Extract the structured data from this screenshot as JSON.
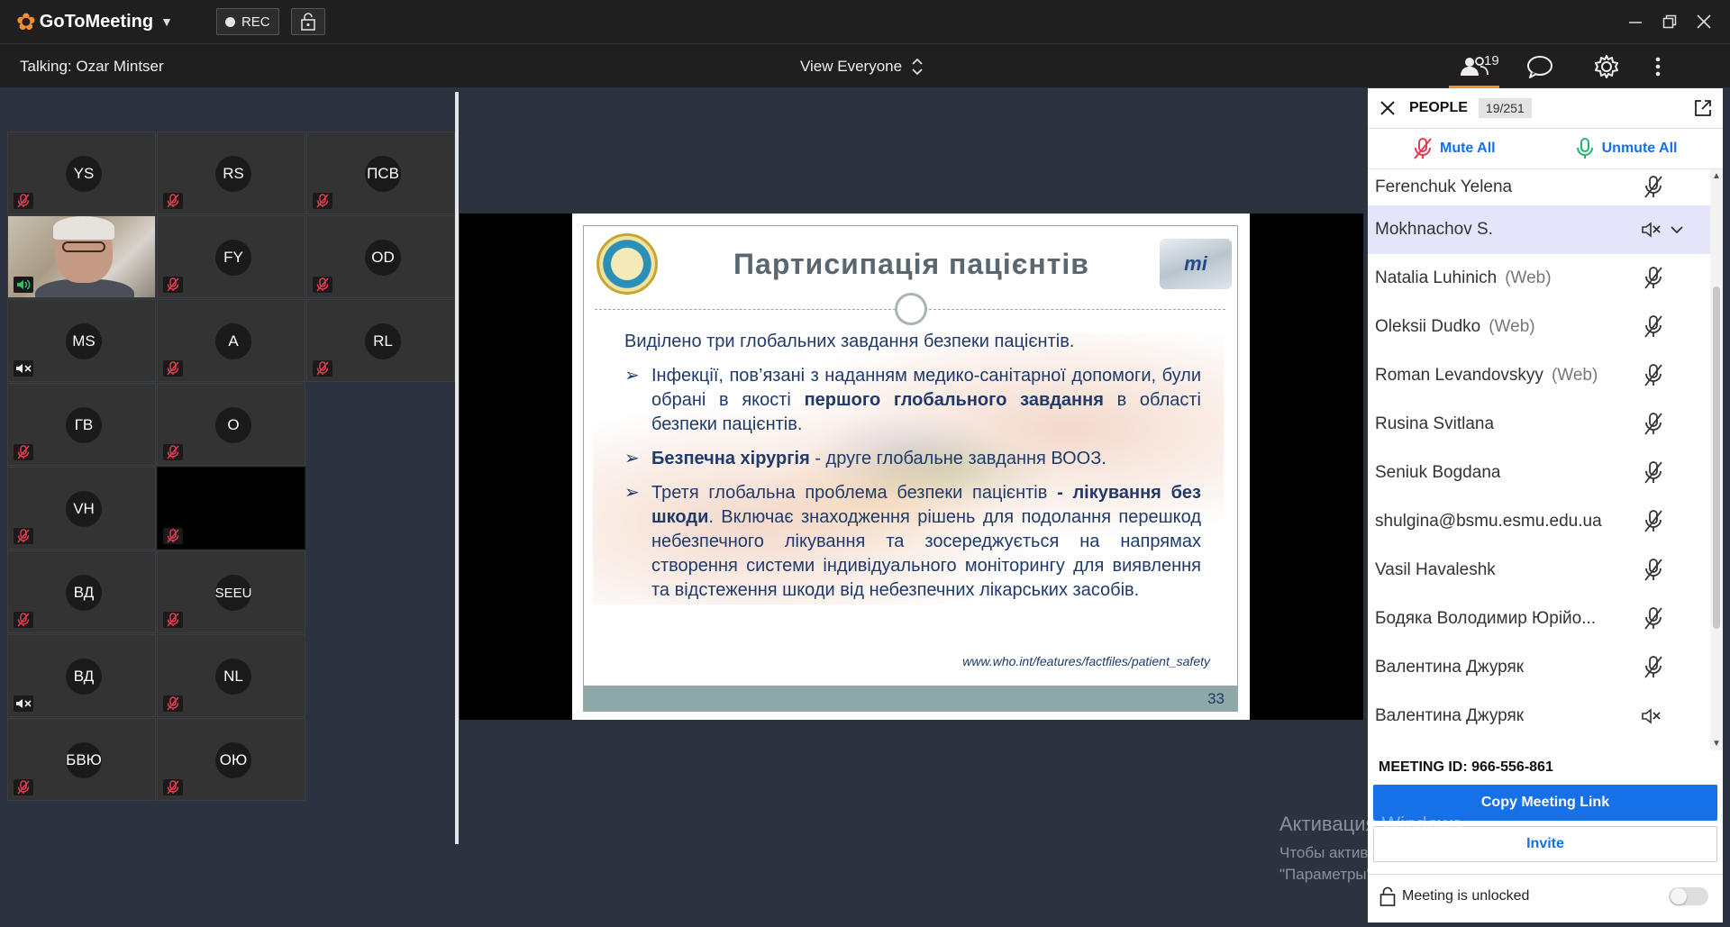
{
  "app": {
    "name": "GoToMeeting",
    "rec_label": "REC",
    "brand_orange": "#f68d2e",
    "accent_blue": "#1670e8"
  },
  "status": {
    "talking": "Talking: Ozar Mintser",
    "view_mode": "View Everyone",
    "attendee_count": "19"
  },
  "tiles": [
    {
      "initials": "YS",
      "mic": "muted"
    },
    {
      "initials": "RS",
      "mic": "muted"
    },
    {
      "initials": "ПСВ",
      "mic": "muted"
    },
    {
      "initials": "",
      "mic": "speaking",
      "video": true
    },
    {
      "initials": "FY",
      "mic": "muted"
    },
    {
      "initials": "OD",
      "mic": "muted"
    },
    {
      "initials": "MS",
      "mic": "speaker-off"
    },
    {
      "initials": "A",
      "mic": "muted"
    },
    {
      "initials": "RL",
      "mic": "muted"
    },
    {
      "initials": "ГВ",
      "mic": "muted"
    },
    {
      "initials": "О",
      "mic": "muted"
    },
    {
      "initials": "VH",
      "mic": "muted"
    },
    {
      "initials": "",
      "mic": "muted",
      "black": true
    },
    {
      "initials": "ВД",
      "mic": "muted"
    },
    {
      "initials": "SEEU",
      "mic": "muted"
    },
    {
      "initials": "ВД",
      "mic": "speaker-off"
    },
    {
      "initials": "NL",
      "mic": "muted"
    },
    {
      "initials": "БВЮ",
      "mic": "muted"
    },
    {
      "initials": "ОЮ",
      "mic": "muted"
    }
  ],
  "slide": {
    "title": "Партисипація пацієнтів",
    "logo_text": "mi",
    "intro": "Виділено три глобальних завдання безпеки пацієнтів.",
    "b1_pre": "Інфекції, пов’язані з наданням медико-санітарної допомоги, були обрані в якості ",
    "b1_bold": "першого глобального завдання",
    "b1_post": " в області безпеки пацієнтів.",
    "b2_bold": "Безпечна хірургія",
    "b2_post": "  -  друге глобальне завдання ВООЗ.",
    "b3_pre": "Третя глобальна проблема безпеки пацієнтів ",
    "b3_bold": "- лікування без шкоди",
    "b3_post": ". Включає знаходження рішень для подолання перешкод небезпечного лікування та зосереджується на напрямах створення системи індивідуального моніторингу для виявлення та відстеження шкоди від небезпечних лікарських засобів.",
    "source": "www.who.int/features/factfiles/patient_safety",
    "page_number": "33",
    "bullet_glyph": "➢"
  },
  "panel": {
    "title": "PEOPLE",
    "count_badge": "19/251",
    "mute_all": "Mute All",
    "unmute_all": "Unmute All",
    "people": [
      {
        "name": "Ferenchuk Yelena",
        "web": "",
        "status": "muted"
      },
      {
        "name": "Mokhnachov S.",
        "web": "",
        "status": "speaker-off",
        "selected": true
      },
      {
        "name": "Natalia Luhinich",
        "web": "(Web)",
        "status": "muted"
      },
      {
        "name": "Oleksii Dudko",
        "web": "(Web)",
        "status": "muted"
      },
      {
        "name": "Roman Levandovskyy",
        "web": "(Web)",
        "status": "muted"
      },
      {
        "name": "Rusina Svitlana",
        "web": "",
        "status": "muted"
      },
      {
        "name": "Seniuk Bogdana",
        "web": "",
        "status": "muted"
      },
      {
        "name": "shulgina@bsmu.esmu.edu.ua",
        "web": "",
        "status": "muted"
      },
      {
        "name": "Vasil Havaleshk",
        "web": "",
        "status": "muted"
      },
      {
        "name": "Бодяка Володимир Юрійо...",
        "web": "",
        "status": "muted"
      },
      {
        "name": "Валентина Джуряк",
        "web": "",
        "status": "muted"
      },
      {
        "name": "Валентина Джуряк",
        "web": "",
        "status": "speaker-off"
      }
    ],
    "meeting_id": "MEETING ID:  966-556-861",
    "copy_link": "Copy Meeting Link",
    "invite": "Invite",
    "lock_status": "Meeting is unlocked"
  },
  "watermark": {
    "title": "Активация Windows",
    "line1": "Чтобы активировать Windows, перейдите в раздел",
    "line2": "\"Параметры\"."
  }
}
